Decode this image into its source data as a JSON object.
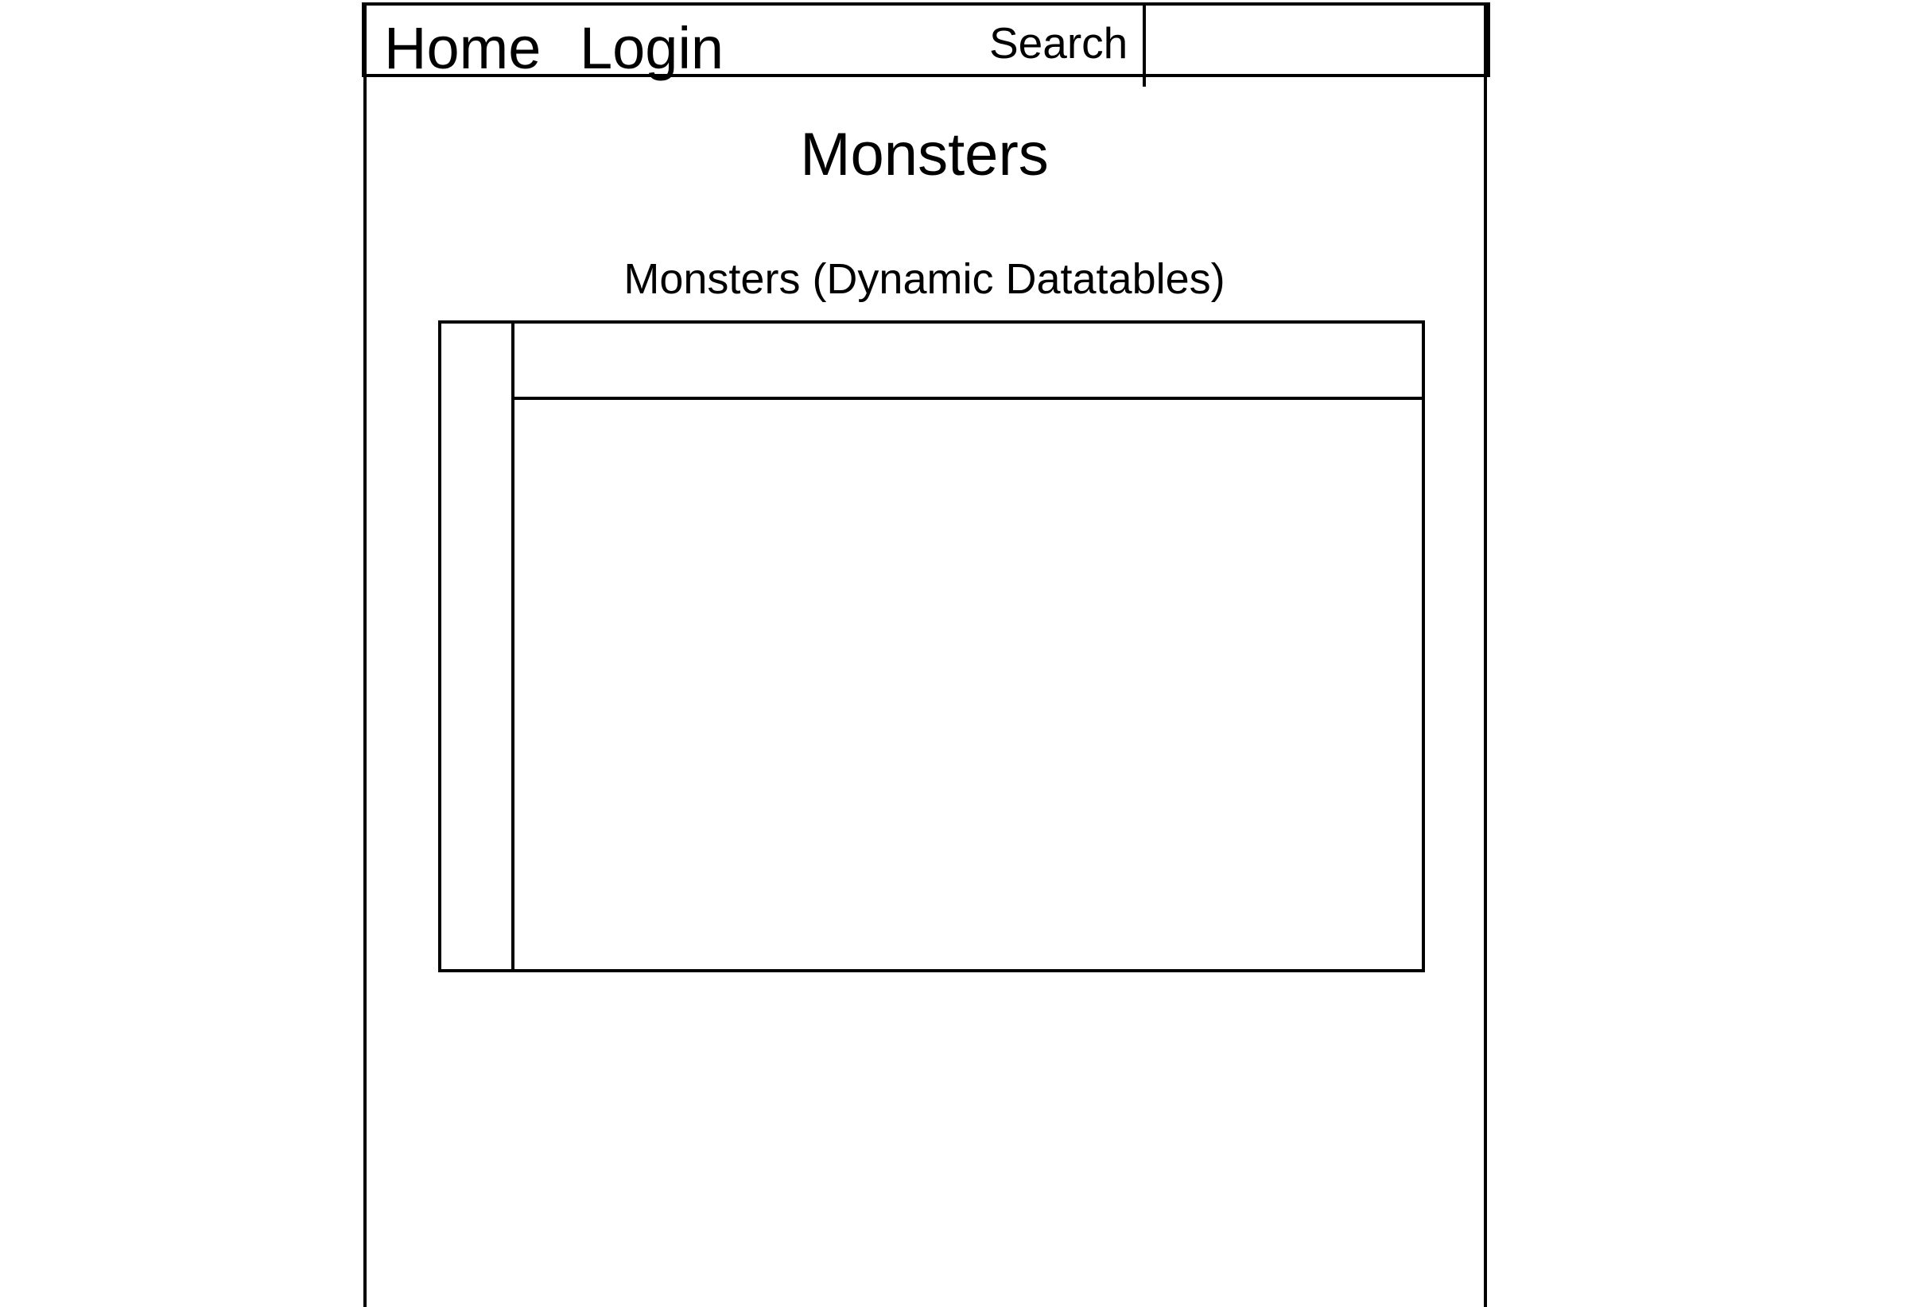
{
  "navbar": {
    "home_label": "Home",
    "login_label": "Login",
    "search_label": "Search",
    "search_value": ""
  },
  "main": {
    "title": "Monsters",
    "table_caption": "Monsters (Dynamic Datatables)"
  }
}
